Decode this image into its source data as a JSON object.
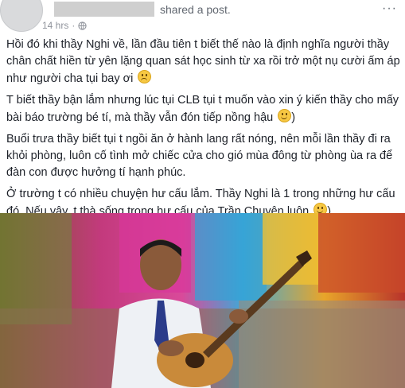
{
  "post": {
    "shared_text": "shared a post.",
    "timestamp": "14 hrs",
    "paragraphs": [
      "Hồi đó khi thầy Nghi về, lần đầu tiên t biết thế nào là định nghĩa người thầy chân chất hiền từ yên lặng quan sát học sinh từ xa rồi trở một nụ cười ấm áp như người cha tụi bay ơi",
      "T biết thầy bận lắm nhưng lúc tụi CLB tụi t muốn vào xin ý kiến thầy cho mấy bài báo trường bé tí, mà thầy vẫn đón tiếp nồng hậu",
      "Buổi trưa thầy biết tụi t ngồi ăn ở hành lang rất nóng, nên mỗi lần thầy đi ra khỏi phòng, luôn cố tình mở chiếc cửa cho gió mùa đông từ phòng ùa ra để đàn con được hưởng tí hạnh phúc.",
      "Ở trường t có nhiều chuyện hư cấu lắm. Thầy Nghi là 1 trong những hư cấu đó. Nếu vậy, t thà sống trong hư cấu của Trần Chuyên luôn"
    ],
    "p2_suffix": ")",
    "p4_suffix": ")",
    "icons": [
      "globe-icon",
      "more-options-icon",
      "smile-emoji",
      "sad-emoji"
    ]
  }
}
